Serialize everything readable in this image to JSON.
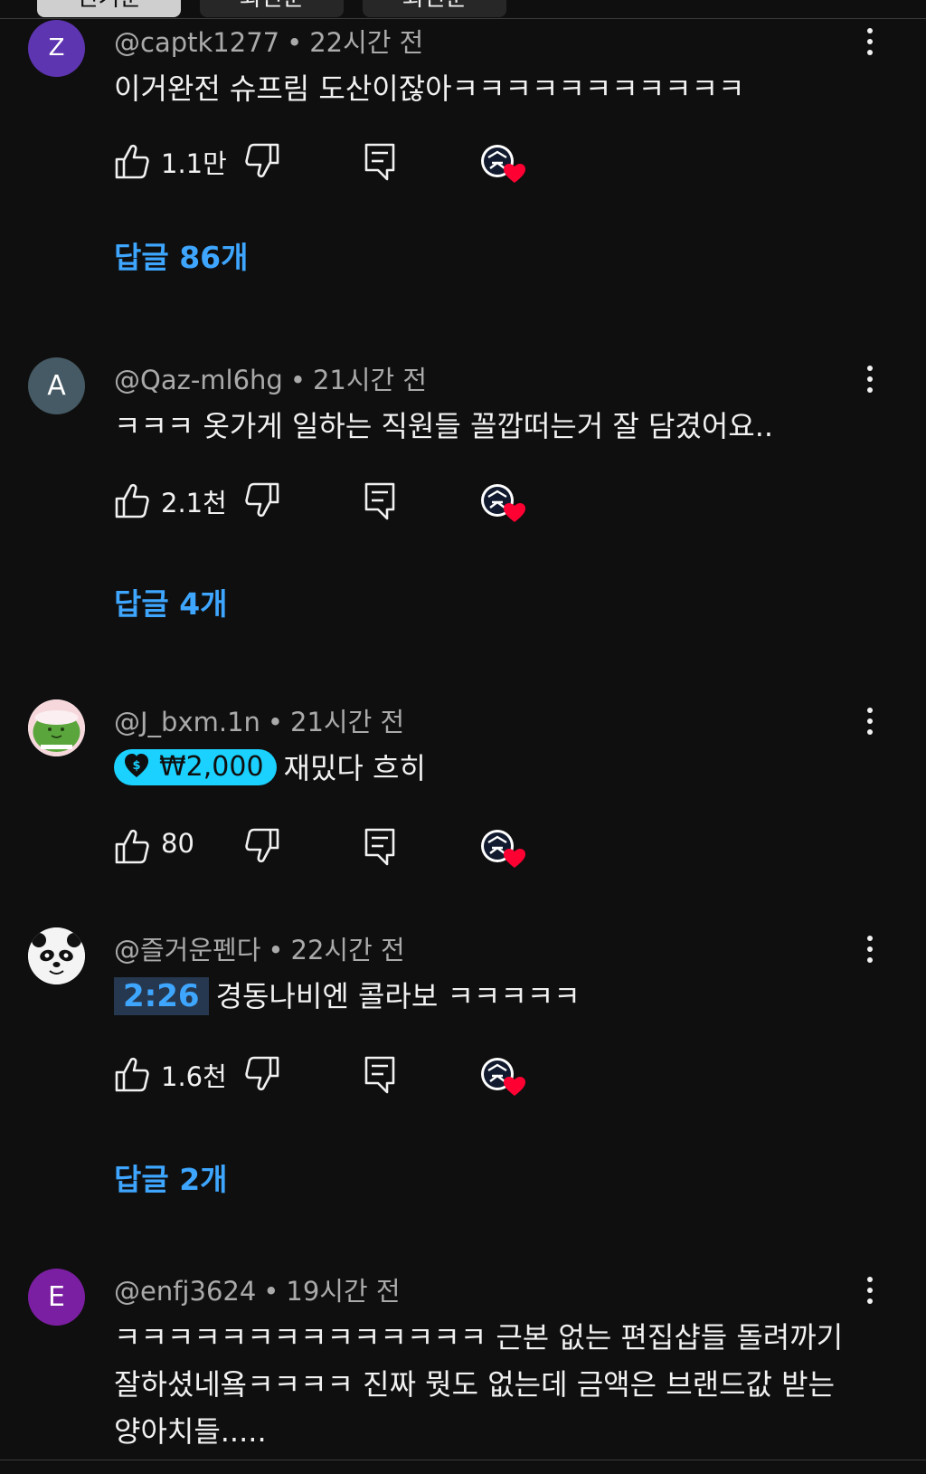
{
  "sort_tabs": [
    {
      "label": "인기순",
      "active": true
    },
    {
      "label": "최신순",
      "active": false
    },
    {
      "label": "회신순",
      "active": false
    }
  ],
  "comments": [
    {
      "author": "@captk1277",
      "time": "22시간 전",
      "avatar_letter": "Z",
      "avatar_color": "#5e35b1",
      "text": "이거완전 슈프림 도산이잖아ㅋㅋㅋㅋㅋㅋㅋㅋㅋㅋㅋ",
      "likes": "1.1만",
      "replies": "답글 86개"
    },
    {
      "author": "@Qaz-ml6hg",
      "time": "21시간 전",
      "avatar_letter": "A",
      "avatar_color": "#455a64",
      "text": "ㅋㅋㅋ 옷가게 일하는 직원들 꼴깝떠는거 잘 담겼어요..",
      "likes": "2.1천",
      "replies": "답글 4개"
    },
    {
      "author": "@J_bxm.1n",
      "time": "21시간 전",
      "avatar_icon": "green-character-avatar",
      "thanks_amount": "₩2,000",
      "text": "재밌다 흐히",
      "likes": "80"
    },
    {
      "author": "@즐거운펜다",
      "time": "22시간 전",
      "avatar_icon": "panda-avatar",
      "timestamp": "2:26",
      "text": "경동나비엔 콜라보 ㅋㅋㅋㅋㅋ",
      "likes": "1.6천",
      "replies": "답글 2개"
    },
    {
      "author": "@enfj3624",
      "time": "19시간 전",
      "avatar_letter": "E",
      "avatar_color": "#7b1fa2",
      "text": "ㅋㅋㅋㅋㅋㅋㅋㅋㅋㅋㅋㅋㅋㅋ 근본 없는 편집샵들 돌려까기 잘하셨네욬ㅋㅋㅋㅋ 진짜 뭣도 없는데 금액은 브랜드값 받는 양아치들....."
    }
  ],
  "colors": {
    "background": "#0f0f0f",
    "link_blue": "#3ea6ff",
    "thanks_cyan": "#1ad1ff",
    "heart_red": "#ff0033",
    "meta_gray": "#aaaaaa"
  }
}
